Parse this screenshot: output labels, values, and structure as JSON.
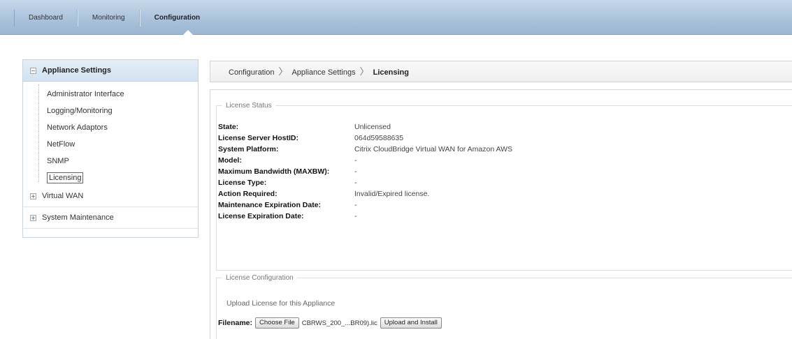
{
  "nav": {
    "tabs": [
      {
        "label": "Dashboard"
      },
      {
        "label": "Monitoring"
      },
      {
        "label": "Configuration"
      }
    ],
    "active": "Configuration"
  },
  "sidebar": {
    "section": {
      "label": "Appliance Settings",
      "toggle": "−"
    },
    "items": [
      {
        "label": "Administrator Interface"
      },
      {
        "label": "Logging/Monitoring"
      },
      {
        "label": "Network Adaptors"
      },
      {
        "label": "NetFlow"
      },
      {
        "label": "SNMP"
      },
      {
        "label": "Licensing"
      }
    ],
    "collapsed": [
      {
        "label": "Virtual WAN",
        "toggle": "+"
      },
      {
        "label": "System Maintenance",
        "toggle": "+"
      }
    ]
  },
  "breadcrumb": {
    "items": [
      "Configuration",
      "Appliance Settings"
    ],
    "current": "Licensing",
    "separator": "〉"
  },
  "license_status": {
    "legend": "License Status",
    "rows": [
      {
        "key": "State:",
        "value": "Unlicensed"
      },
      {
        "key": "License Server HostID:",
        "value": "064d59588635"
      },
      {
        "key": "System Platform:",
        "value": "Citrix CloudBridge Virtual WAN for Amazon AWS"
      },
      {
        "key": "Model:",
        "value": "-"
      },
      {
        "key": "Maximum Bandwidth (MAXBW):",
        "value": "-"
      },
      {
        "key": "License Type:",
        "value": "-"
      },
      {
        "key": "Action Required:",
        "value": "Invalid/Expired license."
      },
      {
        "key": "Maintenance Expiration Date:",
        "value": "-"
      },
      {
        "key": "License Expiration Date:",
        "value": "-"
      }
    ]
  },
  "license_config": {
    "legend": "License Configuration",
    "upload_text": "Upload License for this Appliance",
    "filename_label": "Filename:",
    "choose_button": "Choose File",
    "file_name": "CBRWS_200_...BR09).lic",
    "upload_button": "Upload and Install"
  }
}
